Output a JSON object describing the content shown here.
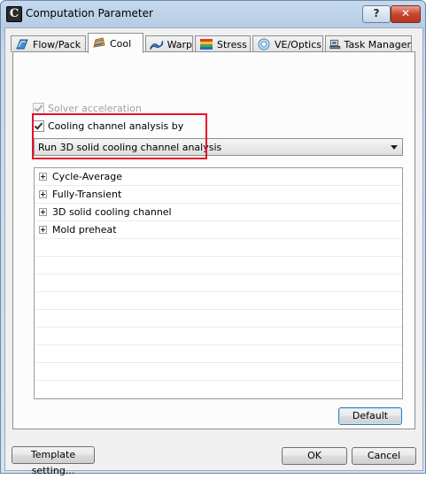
{
  "window": {
    "title": "Computation Parameter",
    "icon_letter": "C",
    "help_label": "?",
    "close_label": "✕"
  },
  "tabs": [
    {
      "label": "Flow/Pack",
      "icon": "flow-pack-icon"
    },
    {
      "label": "Cool",
      "icon": "cool-icon",
      "active": true
    },
    {
      "label": "Warp",
      "icon": "warp-icon"
    },
    {
      "label": "Stress",
      "icon": "stress-icon"
    },
    {
      "label": "VE/Optics",
      "icon": "ve-optics-icon"
    },
    {
      "label": "Task Manager",
      "icon": "task-manager-icon"
    }
  ],
  "cool": {
    "solver_acceleration": {
      "label": "Solver acceleration",
      "checked": true,
      "enabled": false
    },
    "cooling_channel": {
      "label": "Cooling channel analysis by",
      "checked": true
    },
    "analysis_select": {
      "value": "Run 3D solid cooling channel analysis"
    },
    "tree_items": [
      "Cycle-Average",
      "Fully-Transient",
      "3D solid cooling channel",
      "Mold preheat"
    ],
    "default_label": "Default"
  },
  "footer": {
    "template_label": "Template setting...",
    "ok_label": "OK",
    "cancel_label": "Cancel"
  },
  "colors": {
    "highlight": "#e8102a",
    "close": "#c9452f"
  }
}
